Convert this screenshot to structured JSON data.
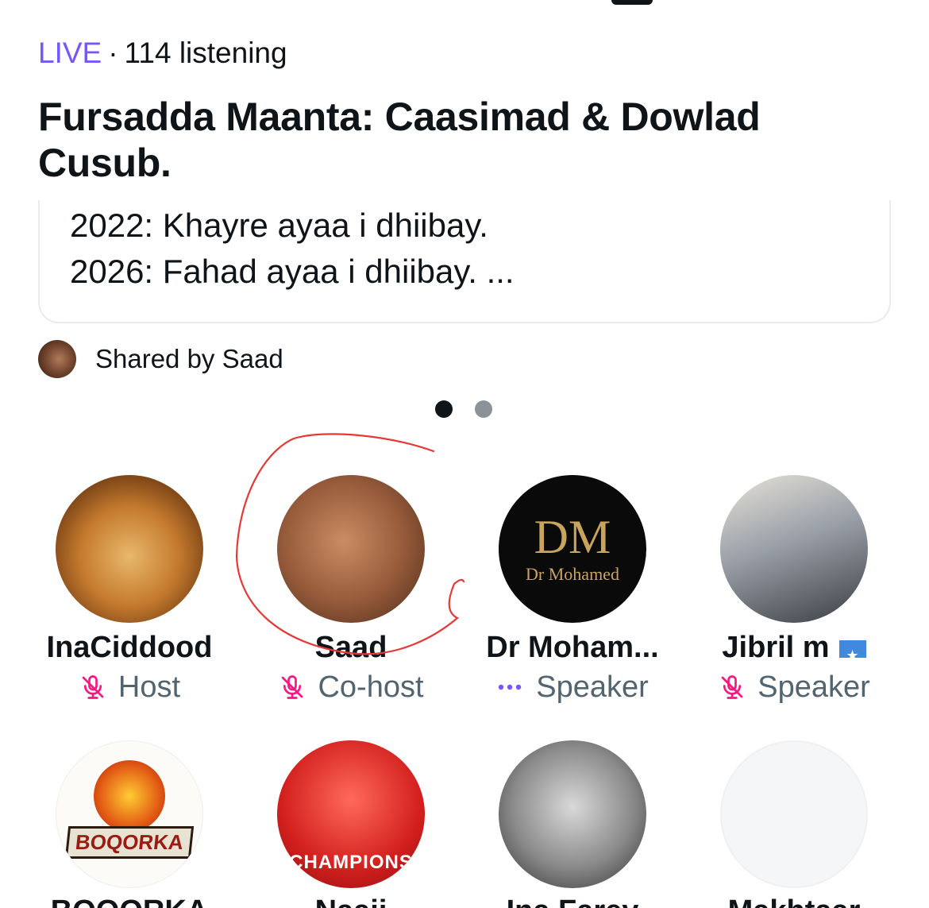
{
  "status": {
    "live_label": "LIVE",
    "separator": "·",
    "listeners": "114 listening"
  },
  "space": {
    "title": "Fursadda Maanta: Caasimad & Dowlad Cusub."
  },
  "tweet_card": {
    "line1": "2022: Khayre ayaa i dhiibay.",
    "line2": "2026: Fahad ayaa i dhiibay.  ..."
  },
  "shared_by": "Shared by Saad",
  "pager": {
    "total": 2,
    "active": 1
  },
  "colors": {
    "live": "#7856ff",
    "mic_muted": "#f91880",
    "speaking": "#7856ff",
    "annotation": "#e53935"
  },
  "participants": [
    {
      "name": "InaCiddood",
      "role": "Host",
      "status_icon": "mic-muted-icon"
    },
    {
      "name": "Saad",
      "role": "Co-host",
      "status_icon": "mic-muted-icon"
    },
    {
      "name": "Dr Moham...",
      "role": "Speaker",
      "status_icon": "speaking-dots-icon",
      "logo_mono": "DM",
      "logo_text": "Dr Mohamed"
    },
    {
      "name": "Jibril m",
      "role": "Speaker",
      "status_icon": "mic-muted-icon",
      "badge": "somalia-flag"
    }
  ],
  "participants_row2": [
    {
      "name": "BOQORKA",
      "logo_word": "BOQORKA"
    },
    {
      "name": "Naaji",
      "verified": true,
      "overlay_text": "CHAMPIONS"
    },
    {
      "name": "Ina Farey"
    },
    {
      "name": "Makhtaar"
    }
  ]
}
